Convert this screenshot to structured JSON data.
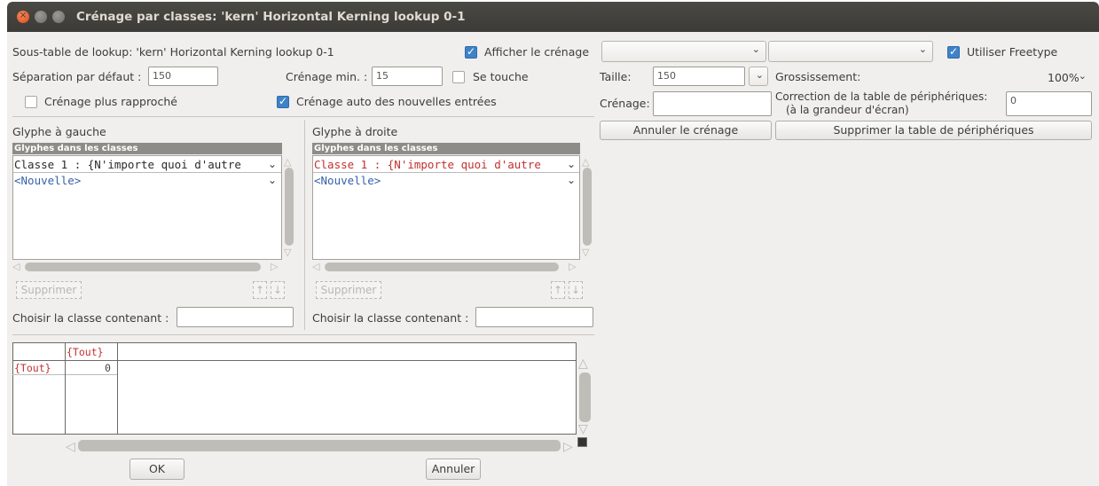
{
  "window": {
    "title": "Crénage par classes: 'kern' Horizontal Kerning lookup 0-1"
  },
  "top": {
    "subtable_label": "Sous-table de lookup: 'kern' Horizontal Kerning lookup 0-1",
    "show_kerning_label": "Afficher le crénage",
    "show_kerning_checked": true,
    "use_freetype_label": "Utiliser Freetype",
    "use_freetype_checked": true,
    "default_sep_label": "Séparation par défaut :",
    "default_sep_value": "150",
    "min_kern_label": "Crénage min. :",
    "min_kern_value": "15",
    "touch_label": "Se touche",
    "touch_checked": false,
    "closer_label": "Crénage plus rapproché",
    "closer_checked": false,
    "auto_label": "Crénage auto des nouvelles entrées",
    "auto_checked": true
  },
  "preview": {
    "size_label": "Taille:",
    "size_value": "150",
    "zoom_label": "Grossissement:",
    "zoom_value": "100%",
    "kern_label": "Crénage:",
    "kern_value": "",
    "device_label_1": "Correction de la table de périphériques:",
    "device_label_2": "(à la grandeur d'écran)",
    "device_value": "0",
    "cancel_kern_button": "Annuler le crénage",
    "delete_device_button": "Supprimer la table de périphériques"
  },
  "left_panel": {
    "title": "Glyphe à gauche",
    "list_header": "Glyphes dans les classes",
    "class1": "Classe 1 : {N'importe quoi d'autre",
    "new_item": "<Nouvelle>",
    "delete_button": "Supprimer",
    "up_arrow": "↑",
    "down_arrow": "↓",
    "choose_label": "Choisir la classe contenant :",
    "choose_value": ""
  },
  "right_panel": {
    "title": "Glyphe à droite",
    "list_header": "Glyphes dans les classes",
    "class1": "Classe 1 : {N'importe quoi d'autre",
    "new_item": "<Nouvelle>",
    "delete_button": "Supprimer",
    "up_arrow": "↑",
    "down_arrow": "↓",
    "choose_label": "Choisir la classe contenant :",
    "choose_value": ""
  },
  "kern_table": {
    "col_header": "{Tout}",
    "row_header": "{Tout}",
    "cell_value": "0"
  },
  "footer": {
    "ok_button": "OK",
    "cancel_button": "Annuler"
  }
}
